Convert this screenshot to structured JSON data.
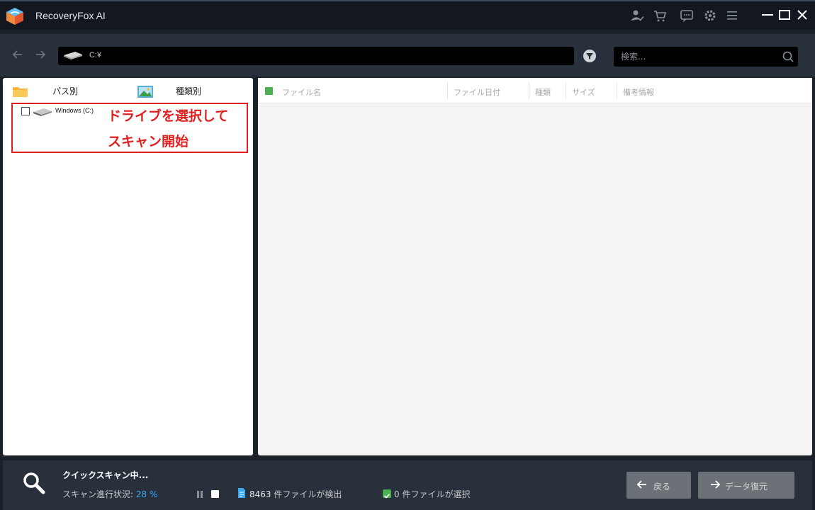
{
  "app": {
    "title": "RecoveryFox AI"
  },
  "nav": {
    "path": "C:¥"
  },
  "search": {
    "placeholder": "検索..."
  },
  "left_panel": {
    "tabs": [
      {
        "label": "パス別"
      },
      {
        "label": "種類別"
      }
    ],
    "tree": {
      "drive_label": "Windows (C:)"
    },
    "annotation": {
      "line1": "ドライブを選択して",
      "line2": "スキャン開始",
      "color": "#e02020"
    }
  },
  "table": {
    "columns": [
      "ファイル名",
      "ファイル日付",
      "種類",
      "サイズ",
      "備考情報"
    ]
  },
  "status": {
    "scan_title": "クイックスキャン中...",
    "progress_label": "スキャン進行状況:",
    "progress_value": "28 %",
    "progress_percent": 28,
    "files_found_count": "8463",
    "files_found_suffix": " 件ファイルが検出",
    "files_selected": "0 件ファイルが選択"
  },
  "buttons": {
    "back": "戻る",
    "recover": "データ復元"
  },
  "colors": {
    "titlebar": "#131820",
    "toolbar": "#28313b",
    "accent_blue": "#3aa7f0",
    "check_green": "#4caf50",
    "button_gray": "#6c7177"
  },
  "icons": {
    "titlebar": [
      "user-check-icon",
      "cart-icon",
      "chat-icon",
      "gear-icon",
      "menu-icon",
      "minimize-icon",
      "maximize-icon",
      "close-icon"
    ],
    "nav": [
      "arrow-left-icon",
      "arrow-right-icon",
      "drive-icon",
      "filter-icon",
      "search-icon"
    ]
  }
}
